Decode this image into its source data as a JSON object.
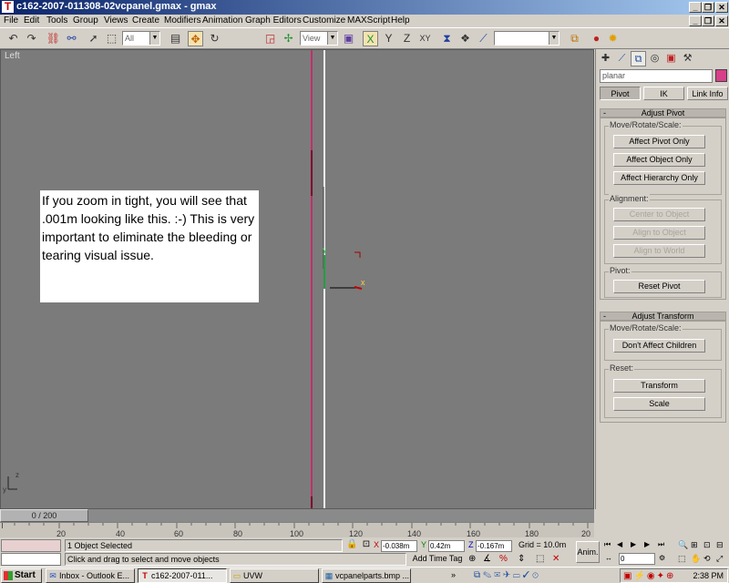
{
  "window": {
    "title": "c162-2007-011308-02vcpanel.gmax - gmax"
  },
  "menu": [
    "File",
    "Edit",
    "Tools",
    "Group",
    "Views",
    "Create",
    "Modifiers",
    "Animation",
    "Graph Editors",
    "Customize",
    "MAXScript",
    "Help"
  ],
  "toolbar": {
    "selection_filter": "All",
    "ref_coord": "View",
    "named_selection": ""
  },
  "viewport": {
    "label": "Left",
    "annotation": "If you zoom in tight, you will see that .001m looking like this. :-) This is very important to eliminate the bleeding or tearing visual issue.",
    "gizmo_y": "y",
    "gizmo_x": "x",
    "axis_z": "z",
    "axis_y": "y"
  },
  "command_panel": {
    "object_name": "planar",
    "swatch_color": "#d8408a",
    "tabs": [
      "Pivot",
      "IK",
      "Link Info"
    ],
    "adjust_pivot": {
      "title": "Adjust Pivot",
      "move_label": "Move/Rotate/Scale:",
      "buttons": [
        "Affect Pivot Only",
        "Affect Object Only",
        "Affect Hierarchy Only"
      ],
      "alignment_label": "Alignment:",
      "align_buttons": [
        "Center to Object",
        "Align to Object",
        "Align to World"
      ],
      "pivot_label": "Pivot:",
      "reset_pivot": "Reset Pivot"
    },
    "adjust_transform": {
      "title": "Adjust Transform",
      "move_label": "Move/Rotate/Scale:",
      "dont_affect": "Don't Affect Children",
      "reset_label": "Reset:",
      "transform": "Transform",
      "scale": "Scale"
    }
  },
  "timeline": {
    "slider": "0 / 200",
    "ticks": [
      "20",
      "40",
      "60",
      "80",
      "100",
      "120",
      "140",
      "160",
      "180",
      "20"
    ]
  },
  "status": {
    "selected": "1 Object Selected",
    "prompt": "Click and drag to select and move objects",
    "x": "-0.038m",
    "y": "0.42m",
    "z": "-0.167m",
    "grid": "Grid = 10.0m",
    "add_time_tag": "Add Time Tag",
    "anim": "Anim.",
    "frame": "0",
    "x_label": "X",
    "y_label": "Y",
    "z_label": "Z"
  },
  "taskbar": {
    "start": "Start",
    "tasks": [
      "Inbox - Outlook E...",
      "c162-2007-011...",
      "UVW",
      "vcpanelparts.bmp ..."
    ],
    "clock": "2:38 PM"
  }
}
